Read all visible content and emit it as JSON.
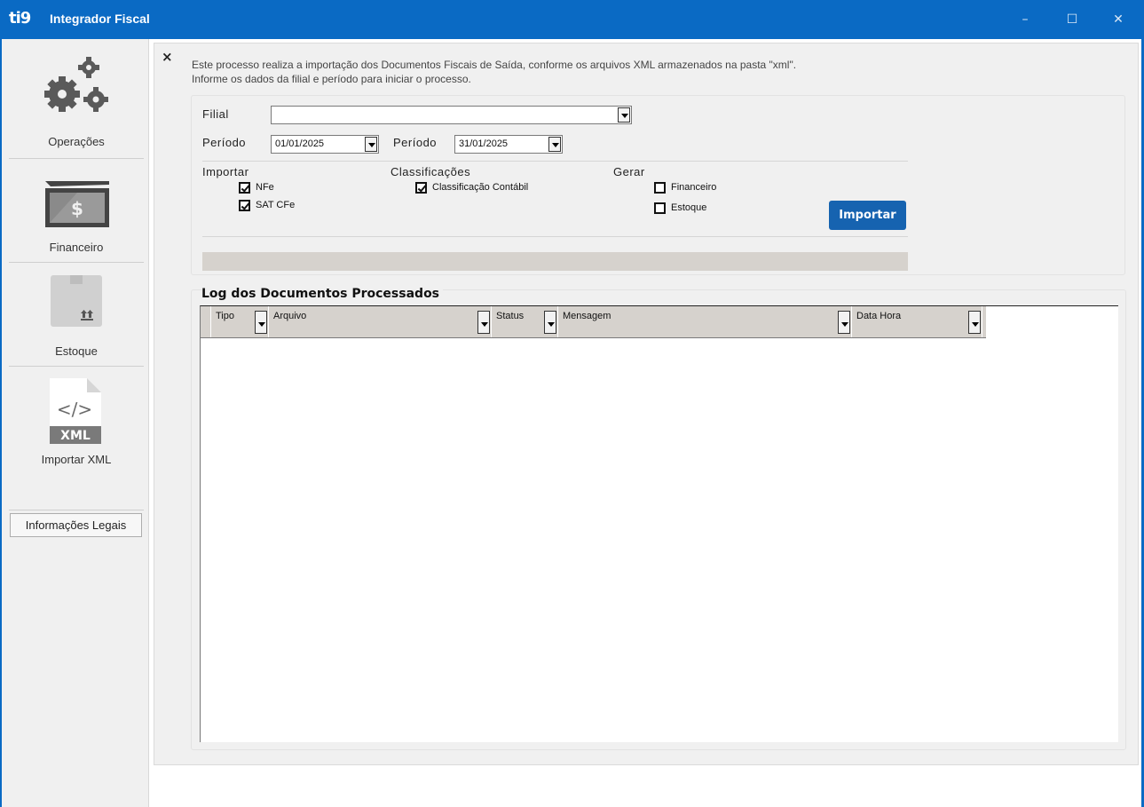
{
  "app": {
    "logo": "ti9",
    "title": "Integrador Fiscal",
    "window_controls": {
      "minimize": "–",
      "maximize": "☐",
      "close": "✕"
    }
  },
  "sidebar": {
    "items": [
      {
        "label": "Operações",
        "icon": "gears-icon"
      },
      {
        "label": "Financeiro",
        "icon": "money-icon"
      },
      {
        "label": "Estoque",
        "icon": "box-icon"
      },
      {
        "label": "Importar XML",
        "icon": "xml-file-icon"
      }
    ],
    "xml_badge": "XML",
    "legal_button": "Informações Legais"
  },
  "main": {
    "close_label": "×",
    "info_line1": "Este processo realiza a importação dos Documentos Fiscais de Saída, conforme os arquivos XML armazenados na pasta \"xml\".",
    "info_line2": "Informe os dados da filial e período para iniciar o processo.",
    "form": {
      "filial_label": "Filial",
      "filial_value": "",
      "periodo_label": "Período",
      "periodo_start": "01/01/2025",
      "periodo_end_label": "Período",
      "periodo_end": "31/01/2025",
      "importar": {
        "label": "Importar",
        "options": [
          {
            "label": "NFe",
            "checked": true
          },
          {
            "label": "SAT CFe",
            "checked": true
          }
        ]
      },
      "classificacoes": {
        "label": "Classificações",
        "options": [
          {
            "label": "Classificação Contábil",
            "checked": true
          }
        ]
      },
      "gerar": {
        "label": "Gerar",
        "options": [
          {
            "label": "Financeiro",
            "checked": false
          },
          {
            "label": "Estoque",
            "checked": false
          }
        ]
      },
      "import_button": "Importar",
      "progress": 0
    },
    "log": {
      "title": "Log dos Documentos Processados",
      "columns": [
        "Tipo",
        "Arquivo",
        "Status",
        "Mensagem",
        "Data Hora"
      ],
      "rows": []
    }
  },
  "colors": {
    "titlebar": "#0a6ac4",
    "button": "#1663b0",
    "panel": "#f0f0f0",
    "header": "#d6d2cd"
  }
}
